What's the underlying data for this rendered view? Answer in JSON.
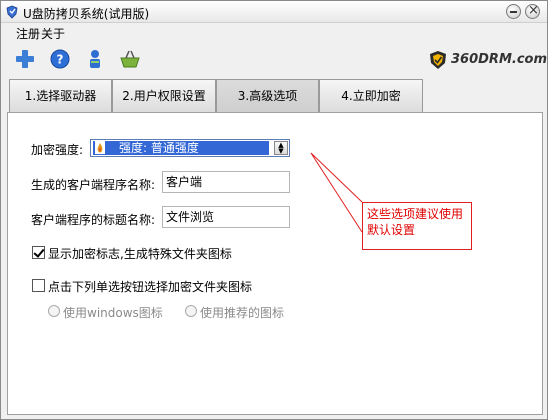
{
  "window": {
    "title": "U盘防拷贝系统(试用版)"
  },
  "menu": {
    "items": [
      "注册",
      "关于"
    ]
  },
  "toolbar": {
    "icons": [
      "add-icon",
      "help-icon",
      "user-icon",
      "basket-icon"
    ],
    "brand": "360DRM.com"
  },
  "tabs": [
    {
      "label": "1.选择驱动器",
      "active": false
    },
    {
      "label": "2.用户权限设置",
      "active": false
    },
    {
      "label": "3.高级选项",
      "active": true
    },
    {
      "label": "4.立即加密",
      "active": false
    }
  ],
  "form": {
    "strength_label": "加密强度:",
    "strength_value": "强度: 普通强度",
    "client_name_label": "生成的客户端程序名称:",
    "client_name_value": "客户端",
    "client_title_label": "客户端程序的标题名称:",
    "client_title_value": "文件浏览",
    "show_mark_label": "显示加密标志,生成特殊文件夹图标",
    "show_mark_checked": true,
    "choose_icon_label": "点击下列单选按钮选择加密文件夹图标",
    "choose_icon_checked": false,
    "radio_windows_label": "使用windows图标",
    "radio_recommended_label": "使用推荐的图标"
  },
  "annotation": {
    "text": "这些选项建议使用默认设置",
    "color": "#e00000"
  },
  "colors": {
    "selection": "#3367d6",
    "window_bg": "#f0f0f0"
  }
}
